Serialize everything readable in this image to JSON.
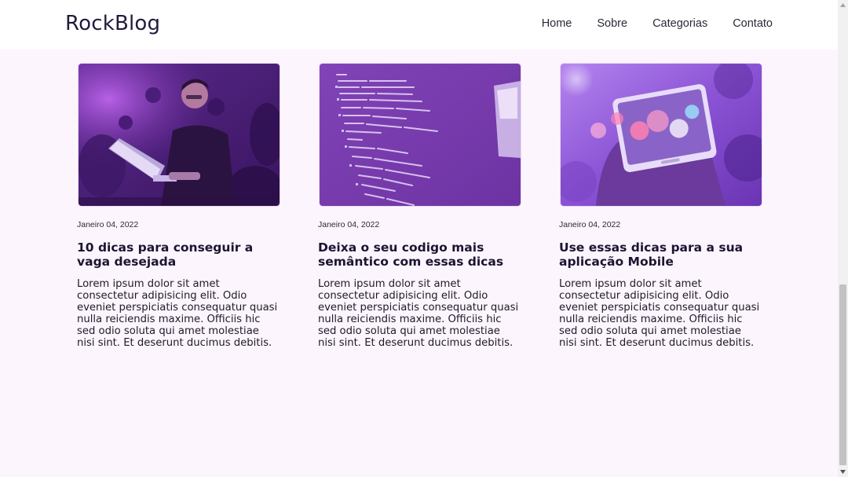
{
  "header": {
    "logo": "RockBlog",
    "nav": [
      "Home",
      "Sobre",
      "Categorias",
      "Contato"
    ]
  },
  "posts": [
    {
      "image": "person-with-laptop-photo",
      "date": "Janeiro 04, 2022",
      "title": "10 dicas para conseguir a vaga desejada",
      "excerpt": "Lorem ipsum dolor sit amet consectetur adipisicing elit. Odio eveniet perspiciatis consequatur quasi nulla reiciendis maxime. Officiis hic sed odio soluta qui amet molestiae nisi sint. Et deserunt ducimus debitis."
    },
    {
      "image": "code-screen-photo",
      "date": "Janeiro 04, 2022",
      "title": "Deixa o seu codigo mais semântico com essas dicas",
      "excerpt": "Lorem ipsum dolor sit amet consectetur adipisicing elit. Odio eveniet perspiciatis consequatur quasi nulla reiciendis maxime. Officiis hic sed odio soluta qui amet molestiae nisi sint. Et deserunt ducimus debitis."
    },
    {
      "image": "smartphone-in-hand-photo",
      "date": "Janeiro 04, 2022",
      "title": "Use essas dicas para a sua aplicação Mobile",
      "excerpt": "Lorem ipsum dolor sit amet consectetur adipisicing elit. Odio eveniet perspiciatis consequatur quasi nulla reiciendis maxime. Officiis hic sed odio soluta qui amet molestiae nisi sint. Et deserunt ducimus debitis."
    }
  ],
  "colors": {
    "background": "#fcf5fd",
    "header": "#ffffff",
    "accent": "#8a3fd0",
    "text": "#1b1532"
  }
}
